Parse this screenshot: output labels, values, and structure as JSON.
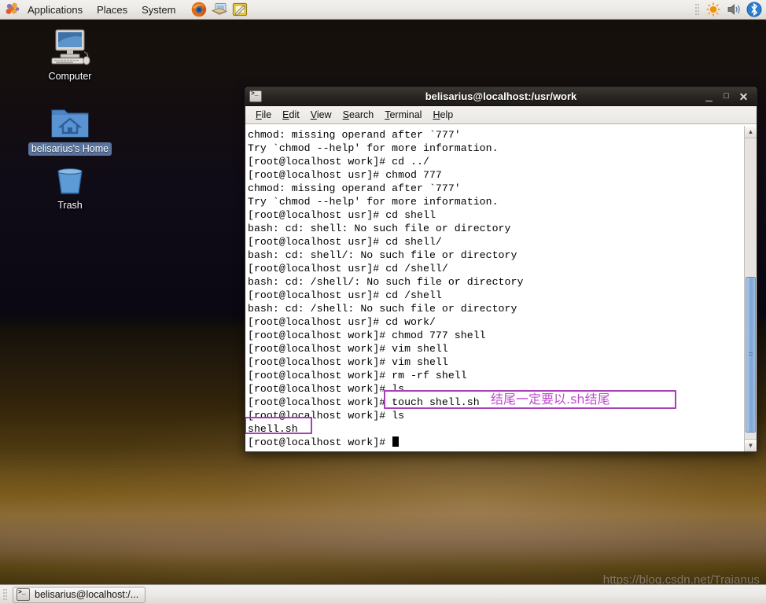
{
  "top_panel": {
    "logo_icon": "gnome-foot-icon",
    "menus": [
      {
        "label": "Applications",
        "name": "menu-applications"
      },
      {
        "label": "Places",
        "name": "menu-places"
      },
      {
        "label": "System",
        "name": "menu-system"
      }
    ],
    "launchers": [
      {
        "name": "firefox-launcher-icon",
        "title": "Firefox Web Browser"
      },
      {
        "name": "evolution-mail-launcher-icon",
        "title": "Evolution Mail"
      },
      {
        "name": "text-editor-launcher-icon",
        "title": "Text Editor"
      }
    ],
    "tray": [
      {
        "name": "brightness-applet-icon"
      },
      {
        "name": "volume-applet-icon"
      },
      {
        "name": "bluetooth-applet-icon"
      }
    ]
  },
  "desktop": {
    "icons": [
      {
        "label": "Computer",
        "name": "desktop-icon-computer",
        "selected": false
      },
      {
        "label": "belisarius's Home",
        "name": "desktop-icon-home",
        "selected": true
      },
      {
        "label": "Trash",
        "name": "desktop-icon-trash",
        "selected": false
      }
    ],
    "watermark": "https://blog.csdn.net/Traianus"
  },
  "terminal": {
    "title": "belisarius@localhost:/usr/work",
    "window_icon": "terminal-icon",
    "window_buttons": {
      "minimize": "_",
      "maximize": "□",
      "close": "✕"
    },
    "menubar": [
      {
        "label": "File",
        "mnemonic": "F",
        "name": "menu-file"
      },
      {
        "label": "Edit",
        "mnemonic": "E",
        "name": "menu-edit"
      },
      {
        "label": "View",
        "mnemonic": "V",
        "name": "menu-view"
      },
      {
        "label": "Search",
        "mnemonic": "S",
        "name": "menu-search"
      },
      {
        "label": "Terminal",
        "mnemonic": "T",
        "name": "menu-terminal"
      },
      {
        "label": "Help",
        "mnemonic": "H",
        "name": "menu-help"
      }
    ],
    "lines": [
      "chmod: missing operand after `777'",
      "Try `chmod --help' for more information.",
      "[root@localhost work]# cd ../",
      "[root@localhost usr]# chmod 777",
      "chmod: missing operand after `777'",
      "Try `chmod --help' for more information.",
      "[root@localhost usr]# cd shell",
      "bash: cd: shell: No such file or directory",
      "[root@localhost usr]# cd shell/",
      "bash: cd: shell/: No such file or directory",
      "[root@localhost usr]# cd /shell/",
      "bash: cd: /shell/: No such file or directory",
      "[root@localhost usr]# cd /shell",
      "bash: cd: /shell: No such file or directory",
      "[root@localhost usr]# cd work/",
      "[root@localhost work]# chmod 777 shell",
      "[root@localhost work]# vim shell",
      "[root@localhost work]# vim shell",
      "[root@localhost work]# rm -rf shell",
      "[root@localhost work]# ls",
      "[root@localhost work]# touch shell.sh",
      "[root@localhost work]# ls",
      "shell.sh"
    ],
    "prompt_line": "[root@localhost work]# ",
    "cursor": "block-cursor"
  },
  "annotations": {
    "accent_color": "#b341c4",
    "note_text": "结尾一定要以.sh结尾",
    "highlight_command": "touch shell.sh",
    "highlight_output": "shell.sh"
  },
  "taskbar": {
    "items": [
      {
        "label": "belisarius@localhost:/...",
        "name": "taskbar-terminal-window",
        "icon": "terminal-icon"
      }
    ]
  }
}
